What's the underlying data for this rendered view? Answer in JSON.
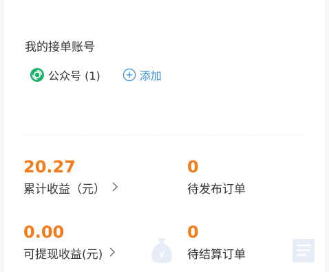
{
  "accounts": {
    "title": "我的接单账号",
    "items": [
      {
        "icon": "wechat-official-account-icon",
        "label": "公众号 (1)"
      }
    ],
    "add_label": "添加"
  },
  "stats": {
    "total_income": {
      "value": "20.27",
      "label": "累计收益（元）"
    },
    "pending_publish": {
      "value": "0",
      "label": "待发布订单"
    },
    "withdrawable_income": {
      "value": "0.00",
      "label": "可提现收益(元)"
    },
    "pending_settlement": {
      "value": "0",
      "label": "待结算订单"
    }
  },
  "colors": {
    "accent_orange": "#f07c1a",
    "link_blue": "#3a8dd8",
    "wechat_green": "#1bb16a"
  }
}
